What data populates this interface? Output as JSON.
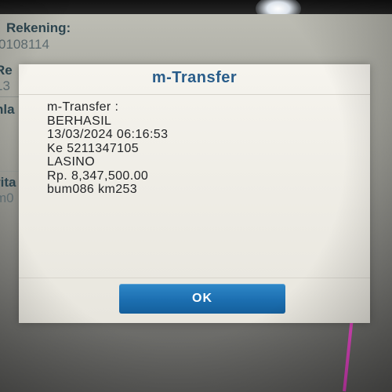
{
  "background": {
    "rows": [
      {
        "text": "Rekening:",
        "style": "bold"
      },
      {
        "text": "0108114",
        "style": "light"
      },
      {
        "text": "Re",
        "style": "bold"
      },
      {
        "text": "13",
        "style": "light"
      },
      {
        "text": "nla",
        "style": "bold"
      },
      {
        "text": "rita",
        "style": "bold"
      },
      {
        "text": "m0",
        "style": "light"
      }
    ]
  },
  "dialog": {
    "title": "m-Transfer",
    "lines": [
      "m-Transfer :",
      "BERHASIL",
      "13/03/2024 06:16:53",
      "Ke 5211347105",
      "LASINO",
      "Rp. 8,347,500.00",
      "bum086 km253"
    ],
    "ok_label": "OK"
  },
  "colors": {
    "title": "#2a5d8a",
    "button": "#1c6fb1",
    "dialog_bg": "#f2f0ea"
  }
}
